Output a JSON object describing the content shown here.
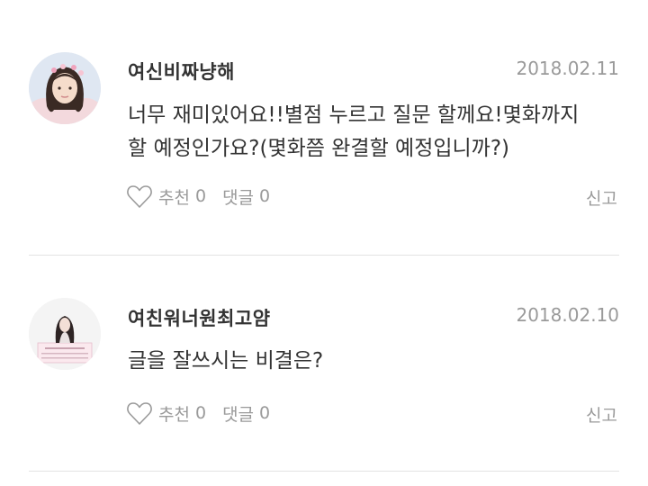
{
  "comments": [
    {
      "username": "여신비짜냥해",
      "date": "2018.02.11",
      "text_line1": "너무 재미있어요!!별점 누르고 질문 할께요!몇화까지",
      "text_line2": "할 예정인가요?(몇화쯤 완결할 예정입니까?)",
      "like_label": "추천",
      "like_count": "0",
      "reply_label": "댓글",
      "reply_count": "0",
      "report_label": "신고"
    },
    {
      "username": "여친워너원최고얌",
      "date": "2018.02.10",
      "text_line1": "글을 잘쓰시는 비결은?",
      "like_label": "추천",
      "like_count": "0",
      "reply_label": "댓글",
      "reply_count": "0",
      "report_label": "신고"
    }
  ],
  "icons": {
    "like": "heart-outline-icon"
  },
  "colors": {
    "text": "#333333",
    "muted": "#9a9a9a",
    "divider": "#e3e3e3"
  }
}
